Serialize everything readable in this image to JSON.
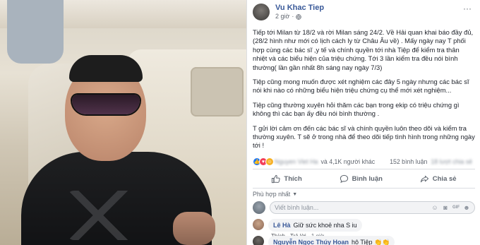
{
  "post": {
    "author": "Vu Khac Tiep",
    "time": "2 giờ",
    "paragraphs": [
      "Tiếp tới Milan từ 18/2 và rời Milan sáng 24/2. Về Hải quan khai báo đầy đủ, (28/2 hình như mới có lịch cách ly từ Châu Âu về) . Mấy ngày nay T phối hợp cùng các bác sĩ ,y tế và chính quyền tới nhà Tiệp để kiểm tra thân nhiệt và các biểu hiện của triệu chứng. Tới 3 lần kiểm tra đều nói bình thường( lần gần nhất 8h sáng nay ngày 7/3)",
      "Tiệp cũng mong muốn được xét nghiệm các đây 5 ngày nhưng các bác sĩ nói khi nào có những biểu hiện triệu chứng cụ thể mới xét nghiệm...",
      "Tiệp cũng thường xuyên hỏi thăm các bạn trong ekip có triệu chứng gì không thì các bạn ấy đều nói bình thường .",
      "T gửi lời cảm ơn đến các bác sĩ và chính quyền luôn theo dõi và kiểm tra thường xuyên. T sẽ ở trong nhà để theo dõi tiếp tình hình trong những ngày tới !"
    ],
    "reactions_names": "Nguyen Viet Ha",
    "reactions_others": "và 4,1K người khác",
    "comment_count": "152 bình luận",
    "share_count": "18 lượt chia sẻ"
  },
  "actions": {
    "like": "Thích",
    "comment": "Bình luận",
    "share": "Chia sẻ"
  },
  "sort_label": "Phù hợp nhất",
  "comment_input": {
    "placeholder": "Viết bình luận..."
  },
  "comments": [
    {
      "name": "Lê Hà",
      "text": "Giữ sức khoẻ nha S iu",
      "like": "Thích",
      "reply": "Trả lời",
      "time": "1 giờ"
    },
    {
      "name": "Nguyễn Ngọc Thúy Hoan",
      "text": "hô Tiệp 👏👏"
    }
  ],
  "colors": {
    "link_blue": "#385898",
    "like_blue": "#2078f4",
    "love_red": "#f33e58",
    "haha_yellow": "#f7b125"
  },
  "icons": [
    "globe-icon",
    "more-icon",
    "like-icon",
    "comment-icon",
    "share-icon",
    "emoji-icon",
    "camera-icon",
    "gif-icon",
    "sticker-icon"
  ]
}
